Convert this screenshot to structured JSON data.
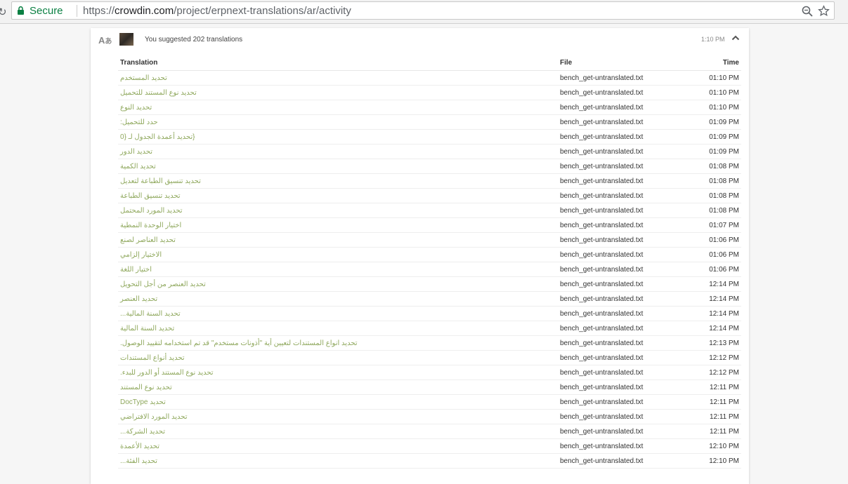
{
  "browser": {
    "secure_label": "Secure",
    "url_scheme": "https://",
    "url_host": "crowdin.com",
    "url_path": "/project/erpnext-translations/ar/activity",
    "secure_color": "#0b8043"
  },
  "activity": {
    "summary": "You suggested 202 translations",
    "time": "1:10 PM",
    "icon": "translate-icon"
  },
  "table": {
    "headers": {
      "translation": "Translation",
      "file": "File",
      "time": "Time"
    },
    "rows": [
      {
        "translation": "تحديد المستخدم",
        "file": "bench_get-untranslated.txt",
        "time": "01:10 PM"
      },
      {
        "translation": "تحديد نوع المستند للتحميل",
        "file": "bench_get-untranslated.txt",
        "time": "01:10 PM"
      },
      {
        "translation": "تحديد النوع",
        "file": "bench_get-untranslated.txt",
        "time": "01:10 PM"
      },
      {
        "translation": "حدد للتحميل:",
        "file": "bench_get-untranslated.txt",
        "time": "01:09 PM"
      },
      {
        "translation": "{تحديد أعمدة الجدول لـ {0",
        "file": "bench_get-untranslated.txt",
        "time": "01:09 PM"
      },
      {
        "translation": "تحديد الدور",
        "file": "bench_get-untranslated.txt",
        "time": "01:09 PM"
      },
      {
        "translation": "تحديد الكمية",
        "file": "bench_get-untranslated.txt",
        "time": "01:08 PM"
      },
      {
        "translation": "تحديد تنسيق الطباعة لتعديل",
        "file": "bench_get-untranslated.txt",
        "time": "01:08 PM"
      },
      {
        "translation": "تحديد تنسيق الطباعة",
        "file": "bench_get-untranslated.txt",
        "time": "01:08 PM"
      },
      {
        "translation": "تحديد المورد المحتمل",
        "file": "bench_get-untranslated.txt",
        "time": "01:08 PM"
      },
      {
        "translation": "اختيار الوحدة النمطية",
        "file": "bench_get-untranslated.txt",
        "time": "01:07 PM"
      },
      {
        "translation": "تحديد العناصر لصنع",
        "file": "bench_get-untranslated.txt",
        "time": "01:06 PM"
      },
      {
        "translation": "الاختيار إلزامي",
        "file": "bench_get-untranslated.txt",
        "time": "01:06 PM"
      },
      {
        "translation": "اختيار اللغة",
        "file": "bench_get-untranslated.txt",
        "time": "01:06 PM"
      },
      {
        "translation": "تحديد العنصر من أجل التحويل",
        "file": "bench_get-untranslated.txt",
        "time": "12:14 PM"
      },
      {
        "translation": "تحديد العنصر",
        "file": "bench_get-untranslated.txt",
        "time": "12:14 PM"
      },
      {
        "translation": "تحديد السنة المالية...",
        "file": "bench_get-untranslated.txt",
        "time": "12:14 PM"
      },
      {
        "translation": "تحديد السنة المالية",
        "file": "bench_get-untranslated.txt",
        "time": "12:14 PM"
      },
      {
        "translation": "تحديد انواع المستندات لتعيين أية \"أذونات مستخدم\" قد تم استخدامه لتقييد الوصول.",
        "file": "bench_get-untranslated.txt",
        "time": "12:13 PM"
      },
      {
        "translation": "تحديد أنواع المستندات",
        "file": "bench_get-untranslated.txt",
        "time": "12:12 PM"
      },
      {
        "translation": "تحديد نوع المستند أو الدور للبدء.",
        "file": "bench_get-untranslated.txt",
        "time": "12:12 PM"
      },
      {
        "translation": "تحديد نوع المستند",
        "file": "bench_get-untranslated.txt",
        "time": "12:11 PM"
      },
      {
        "translation": "تحديد DocType",
        "file": "bench_get-untranslated.txt",
        "time": "12:11 PM"
      },
      {
        "translation": "تحديد المورد الافتراضي",
        "file": "bench_get-untranslated.txt",
        "time": "12:11 PM"
      },
      {
        "translation": "تحديد الشركة...",
        "file": "bench_get-untranslated.txt",
        "time": "12:11 PM"
      },
      {
        "translation": "تحديد الأعمدة",
        "file": "bench_get-untranslated.txt",
        "time": "12:10 PM"
      },
      {
        "translation": "تحديد الفئة...",
        "file": "bench_get-untranslated.txt",
        "time": "12:10 PM"
      }
    ]
  },
  "colors": {
    "translation_text": "#8fa85d",
    "card_bg": "#ffffff",
    "page_bg": "#f6f6f6"
  }
}
